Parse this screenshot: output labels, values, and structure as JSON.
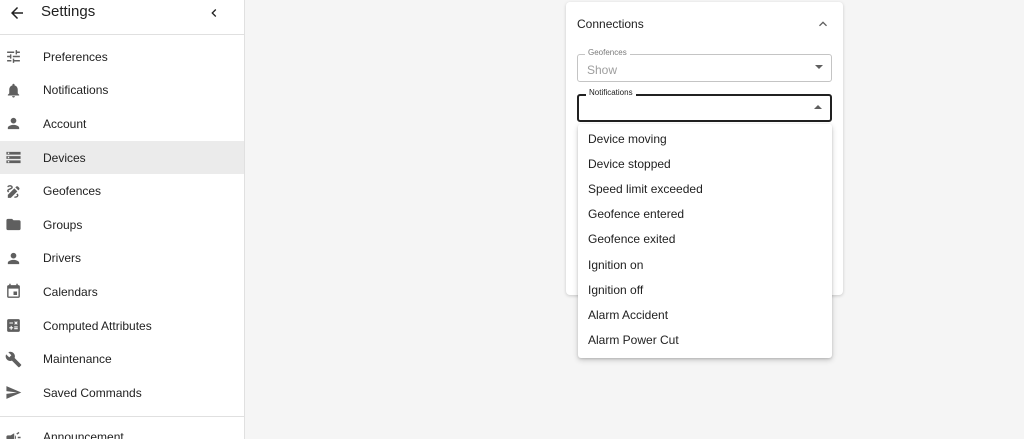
{
  "sidebar": {
    "title": "Settings",
    "items": [
      {
        "label": "Preferences",
        "icon": "tune-icon"
      },
      {
        "label": "Notifications",
        "icon": "bell-icon"
      },
      {
        "label": "Account",
        "icon": "person-icon"
      },
      {
        "label": "Devices",
        "icon": "storage-icon",
        "active": true
      },
      {
        "label": "Geofences",
        "icon": "draw-polygon-icon"
      },
      {
        "label": "Groups",
        "icon": "folder-icon"
      },
      {
        "label": "Drivers",
        "icon": "person-icon"
      },
      {
        "label": "Calendars",
        "icon": "calendar-icon"
      },
      {
        "label": "Computed Attributes",
        "icon": "calculate-icon"
      },
      {
        "label": "Maintenance",
        "icon": "wrench-icon"
      },
      {
        "label": "Saved Commands",
        "icon": "send-icon"
      }
    ],
    "announcement_label": "Announcement"
  },
  "card": {
    "title": "Connections",
    "geofences": {
      "legend": "Geofences",
      "value": "Show"
    },
    "notifications": {
      "legend": "Notifications",
      "value": ""
    }
  },
  "dropdown": {
    "options": [
      "Device moving",
      "Device stopped",
      "Speed limit exceeded",
      "Geofence entered",
      "Geofence exited",
      "Ignition on",
      "Ignition off",
      "Alarm Accident",
      "Alarm Power Cut"
    ]
  },
  "colors": {
    "sidebar_active_bg": "#ebebeb",
    "page_bg": "#f5f5f5",
    "icon": "#5f5f5f"
  }
}
